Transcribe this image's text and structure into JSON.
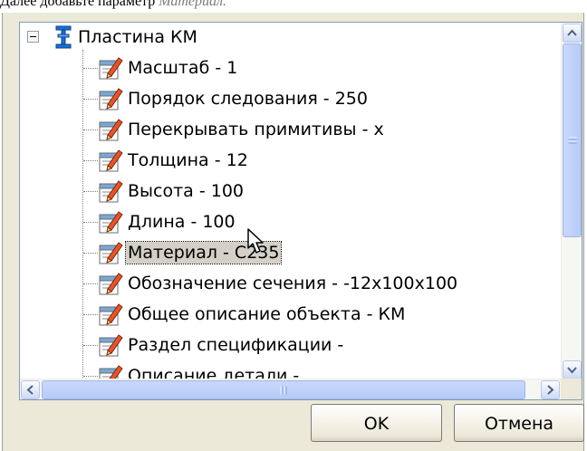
{
  "caption": {
    "text": "Далее добавьте параметр ",
    "italic": "Материал."
  },
  "tree": {
    "root_label": "Пластина КМ",
    "items": [
      {
        "label": "Масштаб - 1"
      },
      {
        "label": "Порядок следования - 250"
      },
      {
        "label": "Перекрывать примитивы - x"
      },
      {
        "label": "Толщина - 12"
      },
      {
        "label": "Высота - 100"
      },
      {
        "label": "Длина - 100"
      },
      {
        "label": "Материал - С235",
        "selected": true
      },
      {
        "label": "Обозначение сечения - -12x100x100"
      },
      {
        "label": "Общее описание объекта - КМ"
      },
      {
        "label": "Раздел спецификации -"
      },
      {
        "label": "Описание детали -"
      }
    ]
  },
  "buttons": {
    "ok": "OK",
    "cancel": "Отмена"
  },
  "colors": {
    "border": "#7f9db9",
    "dialog_bg": "#ece9d8",
    "scroll_thumb": "#c1d3fb"
  },
  "icons": {
    "root": "plate-structure-icon",
    "item": "parameter-edit-icon",
    "cursor": "mouse-pointer-icon"
  }
}
